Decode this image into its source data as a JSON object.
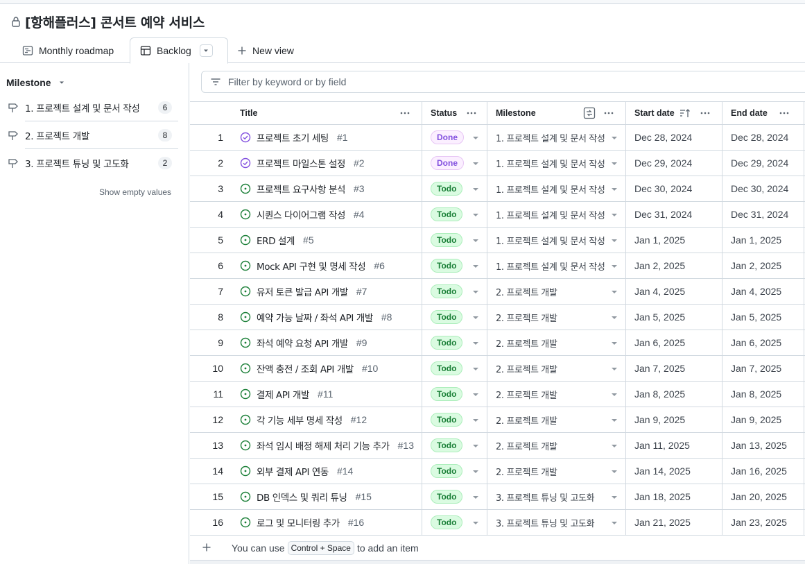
{
  "project": {
    "title": "[항해플러스] 콘서트 예약 서비스"
  },
  "tabs": [
    {
      "label": "Monthly roadmap",
      "icon": "roadmap-icon"
    },
    {
      "label": "Backlog",
      "icon": "table-icon",
      "selected": true
    },
    {
      "label": "New view",
      "icon": "plus-icon"
    }
  ],
  "sidebar": {
    "heading": "Milestone",
    "items": [
      {
        "label": "1. 프로젝트 설계 및 문서 작성",
        "count": "6"
      },
      {
        "label": "2. 프로젝트 개발",
        "count": "8"
      },
      {
        "label": "3. 프로젝트 튜닝 및 고도화",
        "count": "2"
      }
    ],
    "show_empty": "Show empty values"
  },
  "filter": {
    "placeholder": "Filter by keyword or by field"
  },
  "columns": {
    "title": "Title",
    "status": "Status",
    "milestone": "Milestone",
    "start": "Start date",
    "end": "End date"
  },
  "rows": [
    {
      "n": "1",
      "title": "프로젝트 초기 세팅",
      "issue": "#1",
      "status": "Done",
      "milestone": "1. 프로젝트 설계 및 문서 작성",
      "start": "Dec 28, 2024",
      "end": "Dec 28, 2024"
    },
    {
      "n": "2",
      "title": "프로젝트 마일스톤 설정",
      "issue": "#2",
      "status": "Done",
      "milestone": "1. 프로젝트 설계 및 문서 작성",
      "start": "Dec 29, 2024",
      "end": "Dec 29, 2024"
    },
    {
      "n": "3",
      "title": "프로젝트 요구사항 분석",
      "issue": "#3",
      "status": "Todo",
      "milestone": "1. 프로젝트 설계 및 문서 작성",
      "start": "Dec 30, 2024",
      "end": "Dec 30, 2024"
    },
    {
      "n": "4",
      "title": "시퀀스 다이어그램 작성",
      "issue": "#4",
      "status": "Todo",
      "milestone": "1. 프로젝트 설계 및 문서 작성",
      "start": "Dec 31, 2024",
      "end": "Dec 31, 2024"
    },
    {
      "n": "5",
      "title": "ERD 설계",
      "issue": "#5",
      "status": "Todo",
      "milestone": "1. 프로젝트 설계 및 문서 작성",
      "start": "Jan 1, 2025",
      "end": "Jan 1, 2025"
    },
    {
      "n": "6",
      "title": "Mock API 구현 및 명세 작성",
      "issue": "#6",
      "status": "Todo",
      "milestone": "1. 프로젝트 설계 및 문서 작성",
      "start": "Jan 2, 2025",
      "end": "Jan 2, 2025"
    },
    {
      "n": "7",
      "title": "유저 토큰 발급 API 개발",
      "issue": "#7",
      "status": "Todo",
      "milestone": "2. 프로젝트 개발",
      "start": "Jan 4, 2025",
      "end": "Jan 4, 2025"
    },
    {
      "n": "8",
      "title": "예약 가능 날짜 / 좌석 API 개발",
      "issue": "#8",
      "status": "Todo",
      "milestone": "2. 프로젝트 개발",
      "start": "Jan 5, 2025",
      "end": "Jan 5, 2025"
    },
    {
      "n": "9",
      "title": "좌석 예약 요청 API 개발",
      "issue": "#9",
      "status": "Todo",
      "milestone": "2. 프로젝트 개발",
      "start": "Jan 6, 2025",
      "end": "Jan 6, 2025"
    },
    {
      "n": "10",
      "title": "잔액 충전 / 조회 API 개발",
      "issue": "#10",
      "status": "Todo",
      "milestone": "2. 프로젝트 개발",
      "start": "Jan 7, 2025",
      "end": "Jan 7, 2025"
    },
    {
      "n": "11",
      "title": "결제 API 개발",
      "issue": "#11",
      "status": "Todo",
      "milestone": "2. 프로젝트 개발",
      "start": "Jan 8, 2025",
      "end": "Jan 8, 2025"
    },
    {
      "n": "12",
      "title": "각 기능 세부 명세 작성",
      "issue": "#12",
      "status": "Todo",
      "milestone": "2. 프로젝트 개발",
      "start": "Jan 9, 2025",
      "end": "Jan 9, 2025"
    },
    {
      "n": "13",
      "title": "좌석 임시 배정 해제 처리 기능 추가",
      "issue": "#13",
      "status": "Todo",
      "milestone": "2. 프로젝트 개발",
      "start": "Jan 11, 2025",
      "end": "Jan 13, 2025"
    },
    {
      "n": "14",
      "title": "외부 결제 API 연동",
      "issue": "#14",
      "status": "Todo",
      "milestone": "2. 프로젝트 개발",
      "start": "Jan 14, 2025",
      "end": "Jan 16, 2025"
    },
    {
      "n": "15",
      "title": "DB 인덱스 및 쿼리 튜닝",
      "issue": "#15",
      "status": "Todo",
      "milestone": "3. 프로젝트 튜닝 및 고도화",
      "start": "Jan 18, 2025",
      "end": "Jan 20, 2025"
    },
    {
      "n": "16",
      "title": "로그 및 모니터링 추가",
      "issue": "#16",
      "status": "Todo",
      "milestone": "3. 프로젝트 튜닝 및 고도화",
      "start": "Jan 21, 2025",
      "end": "Jan 23, 2025"
    }
  ],
  "add_item": {
    "prefix": "You can use",
    "shortcut": "Control + Space",
    "suffix": "to add an item"
  },
  "colors": {
    "done": "#8250df",
    "todo": "#1a7f37",
    "border": "#d1d9e0"
  }
}
